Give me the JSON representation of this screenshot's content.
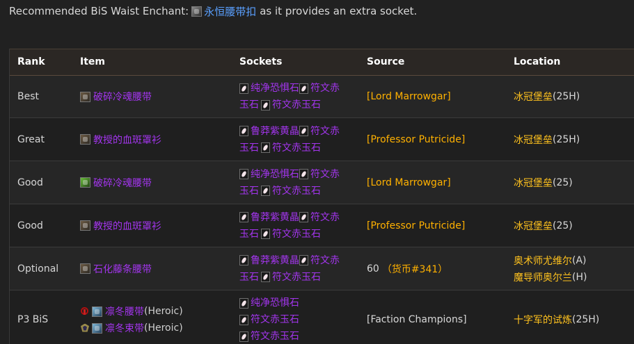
{
  "intro": {
    "text_before": "Recommended BiS Waist Enchant:",
    "enchant_link": "永恒腰带扣",
    "text_after": "as it provides an extra socket."
  },
  "table": {
    "headers": [
      "Rank",
      "Item",
      "Sockets",
      "Source",
      "Location"
    ],
    "rows": [
      {
        "rank": "Best",
        "item": "破碎冷魂腰带",
        "sockets": [
          "纯净恐惧石",
          "符文赤",
          "玉石",
          "符文赤玉石"
        ],
        "source": "[Lord Marrowgar]",
        "location": "冰冠堡垒",
        "location_suffix": "(25H)"
      },
      {
        "rank": "Great",
        "item": "教授的血斑罩衫",
        "sockets": [
          "鲁莽紫黄晶",
          "符文赤",
          "玉石",
          "符文赤玉石"
        ],
        "source": "[Professor Putricide]",
        "location": "冰冠堡垒",
        "location_suffix": " (25H)"
      },
      {
        "rank": "Good",
        "item": "破碎冷魂腰带",
        "sockets": [
          "纯净恐惧石",
          "符文赤",
          "玉石",
          "符文赤玉石"
        ],
        "source": "[Lord Marrowgar]",
        "location": "冰冠堡垒",
        "location_suffix": " (25)"
      },
      {
        "rank": "Good",
        "item": "教授的血斑罩衫",
        "sockets": [
          "鲁莽紫黄晶",
          "符文赤",
          "玉石",
          "符文赤玉石"
        ],
        "source": "[Professor Putricide]",
        "location": "冰冠堡垒",
        "location_suffix": " (25)"
      },
      {
        "rank": "Optional",
        "item": "石化藤条腰带",
        "sockets": [
          "鲁莽紫黄晶",
          "符文赤",
          "玉石",
          "符文赤玉石"
        ],
        "source": "60",
        "source_currency": "（货币#341）",
        "location": "奥术师尤维尔",
        "location_suffix": " (A)",
        "location2": "魔导师奥尔兰",
        "location2_suffix": " (H)"
      },
      {
        "rank": "P3 BiS",
        "item": "凛冬腰带",
        "item_suffix": " (Heroic)",
        "item2": "凛冬束带",
        "item2_suffix": " (Heroic)",
        "sockets_lines": [
          "纯净恐惧石",
          "符文赤玉石",
          "符文赤玉石"
        ],
        "source": "[Faction Champions]",
        "location": "十字军的试炼",
        "location_suffix": " (25H)"
      }
    ]
  },
  "colors": {
    "epic": "#a335ee",
    "source": "#ffb100",
    "location": "#ffc21e",
    "link": "#5aa0ff",
    "background": "#212121"
  }
}
